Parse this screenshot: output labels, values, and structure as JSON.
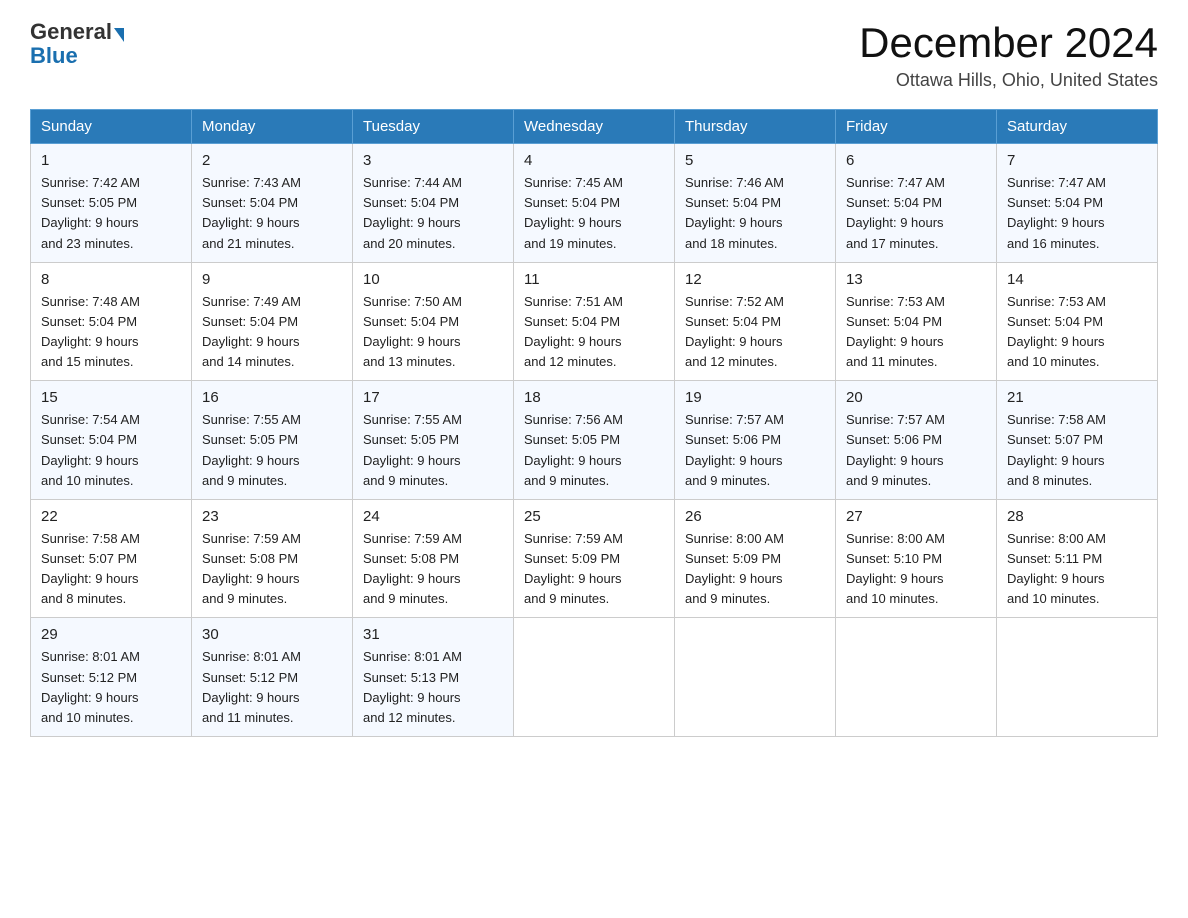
{
  "logo": {
    "general": "General",
    "blue": "Blue"
  },
  "title": "December 2024",
  "location": "Ottawa Hills, Ohio, United States",
  "days_of_week": [
    "Sunday",
    "Monday",
    "Tuesday",
    "Wednesday",
    "Thursday",
    "Friday",
    "Saturday"
  ],
  "weeks": [
    [
      {
        "day": "1",
        "sunrise": "7:42 AM",
        "sunset": "5:05 PM",
        "daylight": "9 hours and 23 minutes."
      },
      {
        "day": "2",
        "sunrise": "7:43 AM",
        "sunset": "5:04 PM",
        "daylight": "9 hours and 21 minutes."
      },
      {
        "day": "3",
        "sunrise": "7:44 AM",
        "sunset": "5:04 PM",
        "daylight": "9 hours and 20 minutes."
      },
      {
        "day": "4",
        "sunrise": "7:45 AM",
        "sunset": "5:04 PM",
        "daylight": "9 hours and 19 minutes."
      },
      {
        "day": "5",
        "sunrise": "7:46 AM",
        "sunset": "5:04 PM",
        "daylight": "9 hours and 18 minutes."
      },
      {
        "day": "6",
        "sunrise": "7:47 AM",
        "sunset": "5:04 PM",
        "daylight": "9 hours and 17 minutes."
      },
      {
        "day": "7",
        "sunrise": "7:47 AM",
        "sunset": "5:04 PM",
        "daylight": "9 hours and 16 minutes."
      }
    ],
    [
      {
        "day": "8",
        "sunrise": "7:48 AM",
        "sunset": "5:04 PM",
        "daylight": "9 hours and 15 minutes."
      },
      {
        "day": "9",
        "sunrise": "7:49 AM",
        "sunset": "5:04 PM",
        "daylight": "9 hours and 14 minutes."
      },
      {
        "day": "10",
        "sunrise": "7:50 AM",
        "sunset": "5:04 PM",
        "daylight": "9 hours and 13 minutes."
      },
      {
        "day": "11",
        "sunrise": "7:51 AM",
        "sunset": "5:04 PM",
        "daylight": "9 hours and 12 minutes."
      },
      {
        "day": "12",
        "sunrise": "7:52 AM",
        "sunset": "5:04 PM",
        "daylight": "9 hours and 12 minutes."
      },
      {
        "day": "13",
        "sunrise": "7:53 AM",
        "sunset": "5:04 PM",
        "daylight": "9 hours and 11 minutes."
      },
      {
        "day": "14",
        "sunrise": "7:53 AM",
        "sunset": "5:04 PM",
        "daylight": "9 hours and 10 minutes."
      }
    ],
    [
      {
        "day": "15",
        "sunrise": "7:54 AM",
        "sunset": "5:04 PM",
        "daylight": "9 hours and 10 minutes."
      },
      {
        "day": "16",
        "sunrise": "7:55 AM",
        "sunset": "5:05 PM",
        "daylight": "9 hours and 9 minutes."
      },
      {
        "day": "17",
        "sunrise": "7:55 AM",
        "sunset": "5:05 PM",
        "daylight": "9 hours and 9 minutes."
      },
      {
        "day": "18",
        "sunrise": "7:56 AM",
        "sunset": "5:05 PM",
        "daylight": "9 hours and 9 minutes."
      },
      {
        "day": "19",
        "sunrise": "7:57 AM",
        "sunset": "5:06 PM",
        "daylight": "9 hours and 9 minutes."
      },
      {
        "day": "20",
        "sunrise": "7:57 AM",
        "sunset": "5:06 PM",
        "daylight": "9 hours and 9 minutes."
      },
      {
        "day": "21",
        "sunrise": "7:58 AM",
        "sunset": "5:07 PM",
        "daylight": "9 hours and 8 minutes."
      }
    ],
    [
      {
        "day": "22",
        "sunrise": "7:58 AM",
        "sunset": "5:07 PM",
        "daylight": "9 hours and 8 minutes."
      },
      {
        "day": "23",
        "sunrise": "7:59 AM",
        "sunset": "5:08 PM",
        "daylight": "9 hours and 9 minutes."
      },
      {
        "day": "24",
        "sunrise": "7:59 AM",
        "sunset": "5:08 PM",
        "daylight": "9 hours and 9 minutes."
      },
      {
        "day": "25",
        "sunrise": "7:59 AM",
        "sunset": "5:09 PM",
        "daylight": "9 hours and 9 minutes."
      },
      {
        "day": "26",
        "sunrise": "8:00 AM",
        "sunset": "5:09 PM",
        "daylight": "9 hours and 9 minutes."
      },
      {
        "day": "27",
        "sunrise": "8:00 AM",
        "sunset": "5:10 PM",
        "daylight": "9 hours and 10 minutes."
      },
      {
        "day": "28",
        "sunrise": "8:00 AM",
        "sunset": "5:11 PM",
        "daylight": "9 hours and 10 minutes."
      }
    ],
    [
      {
        "day": "29",
        "sunrise": "8:01 AM",
        "sunset": "5:12 PM",
        "daylight": "9 hours and 10 minutes."
      },
      {
        "day": "30",
        "sunrise": "8:01 AM",
        "sunset": "5:12 PM",
        "daylight": "9 hours and 11 minutes."
      },
      {
        "day": "31",
        "sunrise": "8:01 AM",
        "sunset": "5:13 PM",
        "daylight": "9 hours and 12 minutes."
      },
      null,
      null,
      null,
      null
    ]
  ],
  "labels": {
    "sunrise": "Sunrise:",
    "sunset": "Sunset:",
    "daylight": "Daylight:"
  }
}
